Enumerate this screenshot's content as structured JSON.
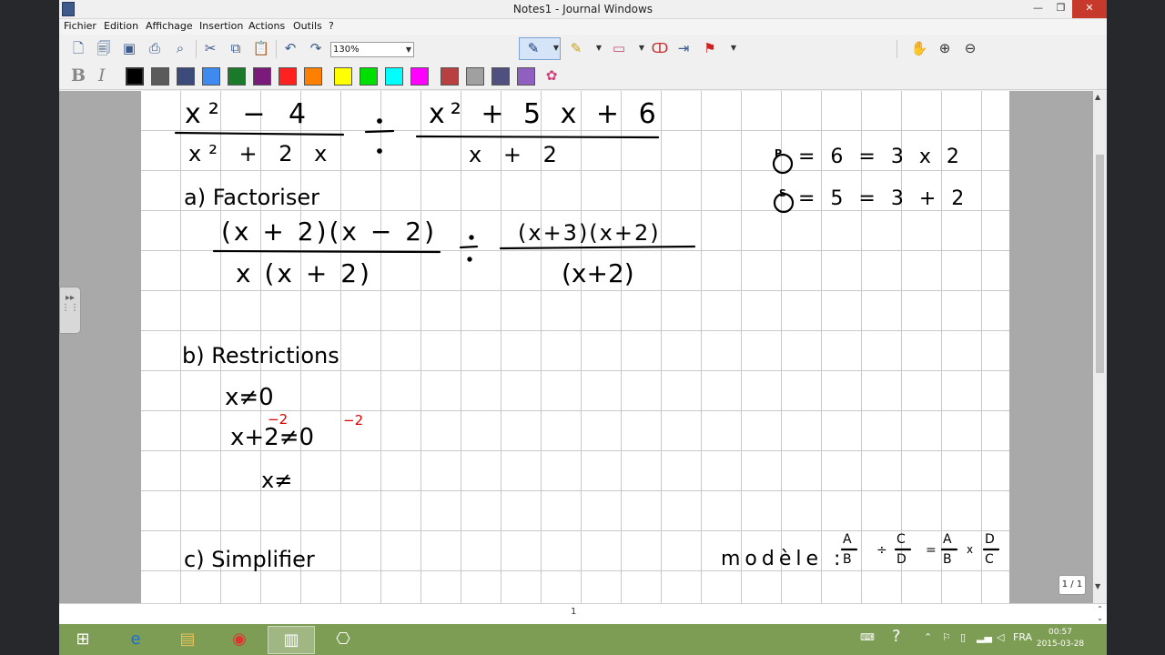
{
  "window": {
    "title": "Notes1 - Journal Windows"
  },
  "menu": [
    "Fichier",
    "Edition",
    "Affichage",
    "Insertion",
    "Actions",
    "Outils",
    "?"
  ],
  "toolbar": {
    "zoom": "130%"
  },
  "format": {
    "bold": "B",
    "italic": "I"
  },
  "colors": [
    "#000000",
    "#5a5a5a",
    "#3b4a7a",
    "#3f8af0",
    "#1a7a2a",
    "#7a1a7a",
    "#ff2020",
    "#ff8000",
    "#ffff00",
    "#00e000",
    "#00ffff",
    "#ff00ff",
    "#b84040",
    "#a0a0a0",
    "#505080",
    "#9060c0"
  ],
  "note": {
    "heading_a": "a) Factoriser",
    "heading_b": "b) Restrictions",
    "heading_c": "c) Simplifier",
    "product_note": "= 6 = 3 x 2",
    "sum_note": "= 5 = 3 + 2",
    "modele": "modèle :"
  },
  "page_badge": "1 / 1",
  "status": {
    "page": "1"
  },
  "clock": {
    "time": "00:57",
    "date": "2015-03-28"
  },
  "tray": {
    "lang": "FRA"
  }
}
